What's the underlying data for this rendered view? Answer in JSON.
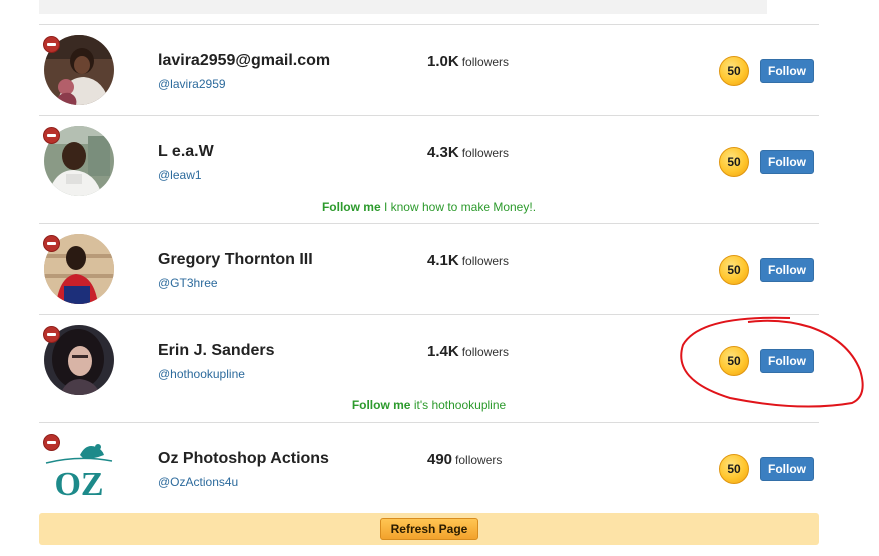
{
  "users": [
    {
      "name": "lavira2959@gmail.com",
      "handle": "@lavira2959",
      "followers_count": "1.0K",
      "followers_label": "followers",
      "coin": "50",
      "follow_label": "Follow"
    },
    {
      "name": "L e.a.W",
      "handle": "@leaw1",
      "followers_count": "4.3K",
      "followers_label": "followers",
      "coin": "50",
      "follow_label": "Follow",
      "promo": {
        "strong": "Follow me",
        "rest": " I know how to make Money!."
      }
    },
    {
      "name": "Gregory Thornton III",
      "handle": "@GT3hree",
      "followers_count": "4.1K",
      "followers_label": "followers",
      "coin": "50",
      "follow_label": "Follow"
    },
    {
      "name": "Erin J. Sanders",
      "handle": "@hothookupline",
      "followers_count": "1.4K",
      "followers_label": "followers",
      "coin": "50",
      "follow_label": "Follow",
      "promo": {
        "strong": "Follow me",
        "rest": " it's hothookupline"
      }
    },
    {
      "name": "Oz Photoshop Actions",
      "handle": "@OzActions4u",
      "followers_count": "490",
      "followers_label": "followers",
      "coin": "50",
      "follow_label": "Follow",
      "avatar_text": "OZ"
    }
  ],
  "footer": {
    "refresh_label": "Refresh Page"
  },
  "colors": {
    "follow_button": "#3b7fc1",
    "promo_text": "#2c9a2c",
    "handle_link": "#2c6a9c",
    "annotation_circle": "#e0141a",
    "footer_bar": "#fde3a7"
  }
}
